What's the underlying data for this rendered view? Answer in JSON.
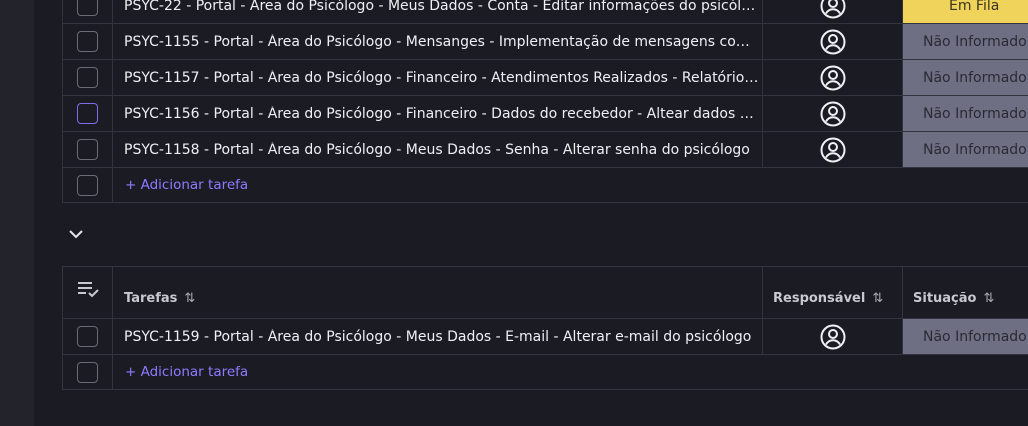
{
  "group1": {
    "rows": [
      {
        "task": "PSYC-22 - Portal - Área do Psicólogo - Meus Dados - Conta - Editar informações do psicólogo",
        "status": "Em Fila"
      },
      {
        "task": "PSYC-1155 - Portal - Área do Psicólogo - Mensanges - Implementação de mensagens com o psicólogo",
        "status": "Não Informado"
      },
      {
        "task": "PSYC-1157 - Portal - Área do Psicólogo - Financeiro - Atendimentos Realizados - Relatório e listagem",
        "status": "Não Informado"
      },
      {
        "task": "PSYC-1156 - Portal - Área do Psicólogo - Financeiro - Dados do recebedor - Altear dados bancários",
        "status": "Não Informado"
      },
      {
        "task": "PSYC-1158 - Portal - Área do Psicólogo - Meus Dados - Senha - Alterar senha do psicólogo",
        "status": "Não Informado"
      }
    ],
    "add_label": "+ Adicionar tarefa"
  },
  "group2": {
    "headers": {
      "tasks": "Tarefas",
      "responsible": "Responsável",
      "status": "Situação",
      "sort_icon": "⇅"
    },
    "rows": [
      {
        "task": "PSYC-1159 - Portal - Área do Psicólogo - Meus Dados - E-mail - Alterar e-mail do psicólogo",
        "status": "Não Informado"
      }
    ],
    "add_label": "+ Adicionar tarefa"
  },
  "icons": {
    "avatar": "user-circle-icon",
    "collapse": "chevron-down-icon",
    "column_menu": "list-check-icon"
  },
  "colors": {
    "status_em_fila": "#f0d35a",
    "status_nao_informado": "#6e6f82",
    "accent": "#8b7cff"
  }
}
